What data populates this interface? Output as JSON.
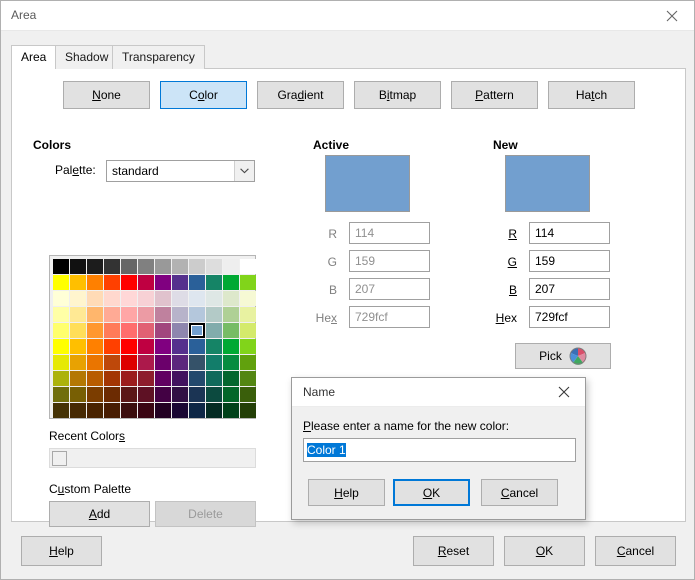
{
  "window": {
    "title": "Area",
    "close_icon": "close-icon"
  },
  "tabs": [
    {
      "label": "Area",
      "active": true
    },
    {
      "label": "Shadow",
      "active": false
    },
    {
      "label": "Transparency",
      "active": false
    }
  ],
  "fill_types": [
    {
      "label": "None",
      "accel": "N",
      "selected": false
    },
    {
      "label": "Color",
      "accel": "C",
      "selected": true
    },
    {
      "label": "Gradient",
      "accel": "d",
      "selected": false
    },
    {
      "label": "Bitmap",
      "accel": "i",
      "selected": false
    },
    {
      "label": "Pattern",
      "accel": "P",
      "selected": false
    },
    {
      "label": "Hatch",
      "accel": "t",
      "selected": false
    }
  ],
  "colors_section": {
    "heading": "Colors",
    "palette_label": "Palette:",
    "palette_value": "standard",
    "dropdown_icon": "chevron-down-icon",
    "recent_heading": "Recent Colors",
    "custom_heading": "Custom Palette",
    "add_label": "Add",
    "delete_label": "Delete",
    "delete_disabled": true,
    "selected_index": 56,
    "palette_colors": [
      "#000000",
      "#111111",
      "#1c1c1c",
      "#333333",
      "#666666",
      "#808080",
      "#999999",
      "#b2b2b2",
      "#cccccc",
      "#dddddd",
      "#eeeeee",
      "#ffffff",
      "#ffff00",
      "#ffbf00",
      "#ff8000",
      "#ff4000",
      "#ff0000",
      "#bf0041",
      "#800080",
      "#55308d",
      "#2a6099",
      "#158466",
      "#00a933",
      "#81d41a",
      "#ffffd7",
      "#fff5ce",
      "#ffdbb6",
      "#ffd8ce",
      "#ffd7d7",
      "#f7d1d5",
      "#e0c2cd",
      "#dedce6",
      "#dee6ef",
      "#dee7e5",
      "#dde8cb",
      "#f6f9d4",
      "#ffffa6",
      "#ffe994",
      "#ffb66c",
      "#ffaa95",
      "#ffa6a6",
      "#ec9ba4",
      "#bf819e",
      "#b7b3ca",
      "#b4c7dc",
      "#b3cac7",
      "#afd095",
      "#e8f2a1",
      "#ffff6d",
      "#ffde59",
      "#ff972f",
      "#ff7b59",
      "#ff6d6d",
      "#e16173",
      "#a1467e",
      "#8e86ae",
      "#729fcf",
      "#81acac",
      "#77bc65",
      "#d4ea6b",
      "#ffff00",
      "#ffbf00",
      "#ff8000",
      "#ff4000",
      "#ff0000",
      "#bf0041",
      "#800080",
      "#55308d",
      "#2a6099",
      "#158466",
      "#00a933",
      "#81d41a",
      "#e6e905",
      "#e8a202",
      "#ea7500",
      "#be480a",
      "#d00",
      "#ac194b",
      "#6b006b",
      "#5b277d",
      "#355269",
      "#127d6a",
      "#068c3f",
      "#61a10d",
      "#acb20c",
      "#b47804",
      "#b85c00",
      "#a33603",
      "#9b1d1d",
      "#8d1d2c",
      "#610061",
      "#42125e",
      "#23496d",
      "#106a5b",
      "#04662e",
      "#538612",
      "#706e0c",
      "#785f04",
      "#7b3d00",
      "#6c2b02",
      "#5b1717",
      "#5e1124",
      "#430144",
      "#311043",
      "#1b3454",
      "#0c4a3f",
      "#036629",
      "#3a5f0b",
      "#443205",
      "#472a03",
      "#492300",
      "#481d02",
      "#3b0d0d",
      "#3a0513",
      "#220022",
      "#1a0733",
      "#0e2746",
      "#042b23",
      "#01421a",
      "#233f07"
    ]
  },
  "active_section": {
    "heading": "Active",
    "swatch_color": "#729fcf",
    "fields": [
      {
        "label": "R",
        "value": "114"
      },
      {
        "label": "G",
        "value": "159"
      },
      {
        "label": "B",
        "value": "207"
      },
      {
        "label": "Hex",
        "value": "729fcf"
      }
    ]
  },
  "new_section": {
    "heading": "New",
    "swatch_color": "#729fcf",
    "fields": [
      {
        "label": "R",
        "value": "114",
        "accel": "R",
        "spinner": true
      },
      {
        "label": "G",
        "value": "159",
        "accel": "G",
        "spinner": true
      },
      {
        "label": "B",
        "value": "207",
        "accel": "B",
        "spinner": true
      },
      {
        "label": "Hex",
        "value": "729fcf",
        "accel": "H",
        "spinner": false
      }
    ],
    "pick_label": "Pick",
    "pick_icon": "color-wheel-icon"
  },
  "name_dialog": {
    "title": "Name",
    "close_icon": "close-icon",
    "prompt": "Please enter a name for the new color:",
    "input_value": "Color 1",
    "input_selected": true,
    "buttons": [
      {
        "label": "Help",
        "accel": "H",
        "focus": false
      },
      {
        "label": "OK",
        "accel": "O",
        "focus": true
      },
      {
        "label": "Cancel",
        "accel": "C",
        "focus": false
      }
    ]
  },
  "bottom_buttons": {
    "help": "Help",
    "reset": "Reset",
    "ok": "OK",
    "cancel": "Cancel"
  },
  "accent_colors": {
    "focus_blue": "#0078d7",
    "selection_blue": "#0078d7",
    "selected_fill": "#cce4f7"
  }
}
